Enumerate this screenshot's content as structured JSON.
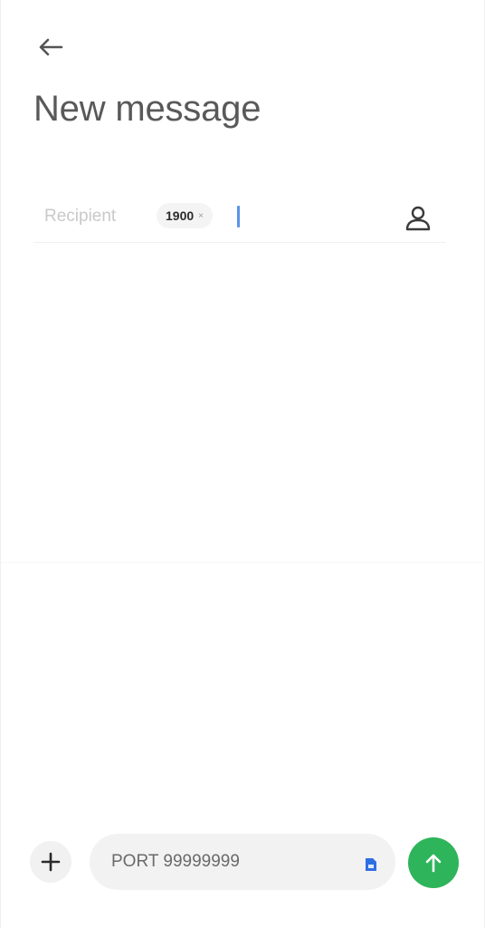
{
  "header": {
    "back_icon": "arrow-left-icon",
    "title": "New message"
  },
  "recipient": {
    "label": "Recipient",
    "chip_text": "1900",
    "chip_close_glyph": "×",
    "contact_icon": "person-icon"
  },
  "compose": {
    "attach_icon": "plus-icon",
    "message_value": "PORT 99999999",
    "sim_icon": "sim-card-icon",
    "send_icon": "arrow-up-icon"
  },
  "colors": {
    "send_button": "#2eb45a",
    "caret": "#5a93e6",
    "sim_icon": "#2f6fe4"
  }
}
